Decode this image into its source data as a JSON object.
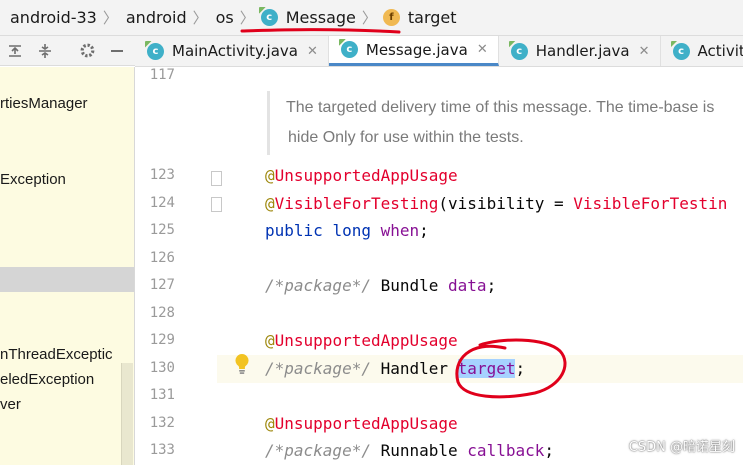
{
  "breadcrumb": {
    "items": [
      {
        "label": "android-33"
      },
      {
        "label": "android"
      },
      {
        "label": "os"
      },
      {
        "label": "Message",
        "icon": "class-icon"
      },
      {
        "label": "target",
        "icon": "field-icon"
      }
    ]
  },
  "project_panel": {
    "items": [
      {
        "label": "rtiesManager"
      },
      {
        "label": "Exception"
      },
      {
        "label": ""
      },
      {
        "label": "nThreadExceptic"
      },
      {
        "label": "eledException"
      },
      {
        "label": "ver"
      }
    ]
  },
  "tabs": [
    {
      "label": "MainActivity.java",
      "icon": "class-icon",
      "active": false
    },
    {
      "label": "Message.java",
      "icon": "class-icon",
      "active": true
    },
    {
      "label": "Handler.java",
      "icon": "class-icon",
      "active": false
    },
    {
      "label": "ActivityThr",
      "icon": "class-icon",
      "active": false
    }
  ],
  "editor": {
    "doc_comment": [
      "The targeted delivery time of this message. The time-base is",
      "hide Only for use within the tests."
    ],
    "line_numbers": [
      "117",
      "123",
      "124",
      "125",
      "126",
      "127",
      "128",
      "129",
      "130",
      "131",
      "132",
      "133"
    ],
    "code": {
      "l123": {
        "at": "@",
        "name": "UnsupportedAppUsage"
      },
      "l124": {
        "at": "@",
        "name": "VisibleForTesting",
        "rest": "(visibility = ",
        "value": "VisibleForTestin"
      },
      "l125": {
        "kw1": "public",
        "kw2": "long",
        "field": "when",
        "end": ";"
      },
      "l127": {
        "comment": "/*package*/",
        "type": " Bundle ",
        "field": "data",
        "end": ";"
      },
      "l129": {
        "at": "@",
        "name": "UnsupportedAppUsage"
      },
      "l130": {
        "comment": "/*package*/",
        "type": " Handler ",
        "field": "target",
        "end": ";"
      },
      "l132": {
        "at": "@",
        "name": "UnsupportedAppUsage"
      },
      "l133": {
        "comment": "/*package*/",
        "type": " Runnable ",
        "field": "callback",
        "end": ";"
      }
    }
  },
  "watermark": "CSDN @暗诺星刻",
  "colors": {
    "accent": "#4a88c7",
    "annotation_red": "#e3002d",
    "keyword_blue": "#0033b3",
    "field_purple": "#871094",
    "selection": "#a6d2ff",
    "project_bg": "#fdfbe1",
    "ink_red": "#e0001b"
  }
}
